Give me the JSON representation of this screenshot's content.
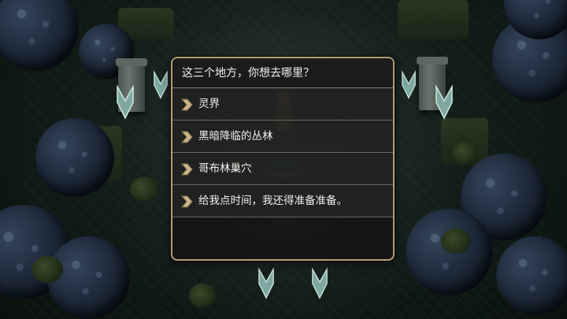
{
  "dialog": {
    "prompt": "这三个地方，你想去哪里？",
    "choices": [
      {
        "label": "灵界",
        "icon": "chevron-right-icon"
      },
      {
        "label": "黑暗降临的丛林",
        "icon": "chevron-right-icon"
      },
      {
        "label": "哥布林巢穴",
        "icon": "chevron-right-icon"
      },
      {
        "label": "给我点时间，我还得准备准备。",
        "icon": "chevron-right-icon"
      }
    ]
  },
  "colors": {
    "dialog_border": "#b89e74",
    "choice_arrow": "#c9b48a",
    "crystal": "#a9c8c2"
  }
}
